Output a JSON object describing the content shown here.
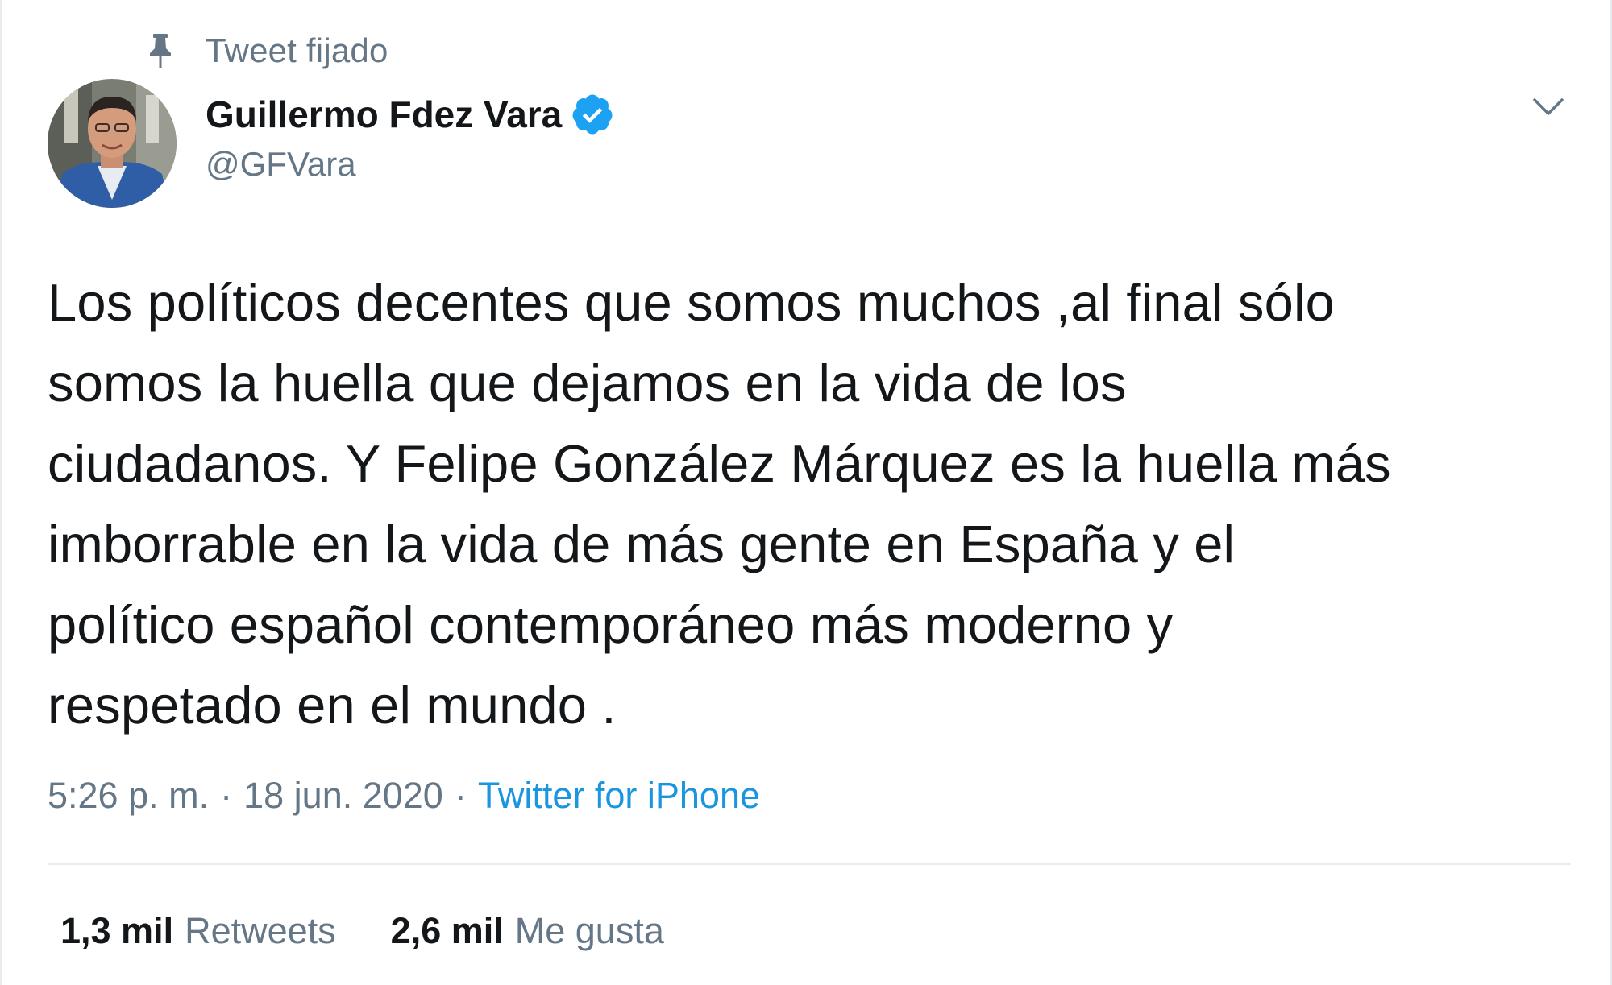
{
  "pinned": {
    "label": "Tweet fijado",
    "icon": "pin-icon"
  },
  "author": {
    "display_name": "Guillermo Fdez Vara",
    "handle": "@GFVara",
    "verified": true,
    "verified_color": "#1da1f2"
  },
  "menu": {
    "icon": "chevron-down-icon"
  },
  "tweet": {
    "text": "Los políticos decentes que somos muchos ,al final sólo\nsomos la huella que dejamos en la vida de los\nciudadanos. Y Felipe González Márquez es la huella más\nimborrable en la vida de más gente en España y el\npolítico español contemporáneo más moderno y\nrespetado en el mundo ."
  },
  "meta": {
    "time": "5:26 p. m.",
    "separator": "·",
    "date": "18 jun. 2020",
    "source": "Twitter for iPhone",
    "link_color": "#1b95e0"
  },
  "stats": {
    "retweets_count": "1,3 mil",
    "retweets_label": "Retweets",
    "likes_count": "2,6 mil",
    "likes_label": "Me gusta"
  }
}
